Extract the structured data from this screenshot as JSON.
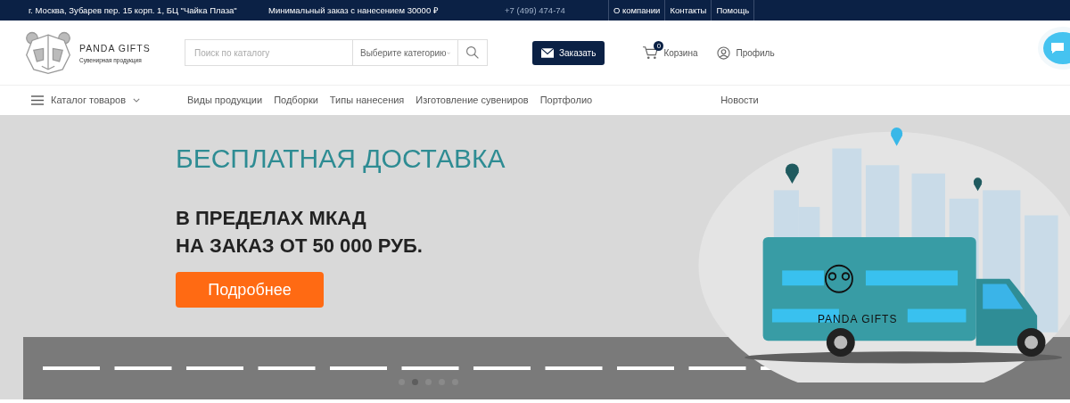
{
  "top_bar": {
    "address": "г. Москва, Зубарев пер. 15 корп. 1, БЦ \"Чайка Плаза\"",
    "min_order": "Минимальный заказ с нанесением 30000 ₽",
    "phone": "+7 (499) 474-74",
    "links": [
      "О компании",
      "Контакты",
      "Помощь"
    ]
  },
  "header": {
    "logo_title": "PANDA GIFTS",
    "logo_subtitle": "Сувенирная продукция",
    "search": {
      "placeholder": "Поиск по каталогу"
    },
    "category": "Выберите категорию",
    "order_button": "Заказать",
    "cart": {
      "label": "Корзина",
      "count": "0"
    },
    "profile": "Профиль"
  },
  "nav": {
    "catalog": "Каталог товаров",
    "items": [
      "Виды продукции",
      "Подборки",
      "Типы нанесения",
      "Изготовление сувениров",
      "Портфолио"
    ],
    "news": "Новости"
  },
  "banner": {
    "title": "БЕСПЛАТНАЯ ДОСТАВКА",
    "subtitle_lines": [
      "В ПРЕДЕЛАХ МКАД",
      "НА ЗАКАЗ ОТ 50 000 РУБ."
    ],
    "button": "Подробнее",
    "van_text": "PANDA GIFTS",
    "slides": [
      {
        "selected": false
      },
      {
        "selected": true
      },
      {
        "selected": false
      },
      {
        "selected": false
      },
      {
        "selected": false
      }
    ]
  }
}
